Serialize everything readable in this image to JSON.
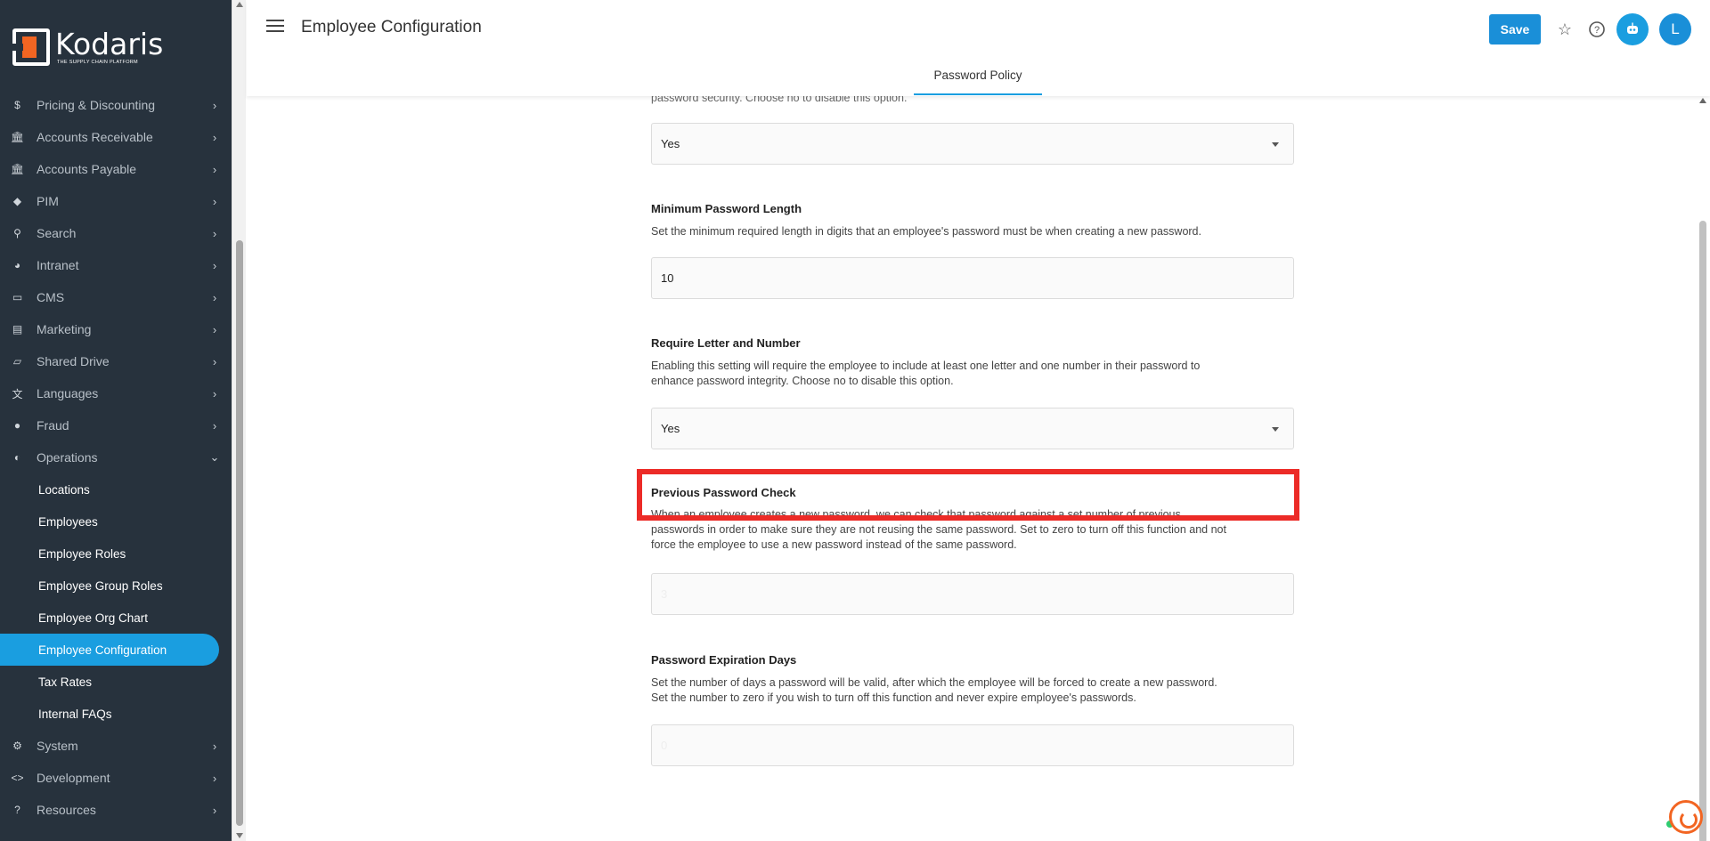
{
  "brand": {
    "name": "Kodaris",
    "tagline": "THE SUPPLY CHAIN PLATFORM"
  },
  "sidebar": {
    "items": [
      {
        "label": "Pricing & Discounting",
        "icon": "dollar-icon",
        "glyph": "$"
      },
      {
        "label": "Accounts Receivable",
        "icon": "bank-icon",
        "glyph": "🏛"
      },
      {
        "label": "Accounts Payable",
        "icon": "bank-icon",
        "glyph": "🏛"
      },
      {
        "label": "PIM",
        "icon": "tag-icon",
        "glyph": "◆"
      },
      {
        "label": "Search",
        "icon": "search-icon",
        "glyph": "⚲"
      },
      {
        "label": "Intranet",
        "icon": "globe-icon",
        "glyph": "◕"
      },
      {
        "label": "CMS",
        "icon": "web-icon",
        "glyph": "▭"
      },
      {
        "label": "Marketing",
        "icon": "id-card-icon",
        "glyph": "▤"
      },
      {
        "label": "Shared Drive",
        "icon": "folder-icon",
        "glyph": "▱"
      },
      {
        "label": "Languages",
        "icon": "translate-icon",
        "glyph": "文"
      },
      {
        "label": "Fraud",
        "icon": "alert-icon",
        "glyph": "●"
      },
      {
        "label": "Operations",
        "icon": "operations-icon",
        "glyph": "◐"
      }
    ],
    "operations_sub": [
      {
        "label": "Locations"
      },
      {
        "label": "Employees"
      },
      {
        "label": "Employee Roles"
      },
      {
        "label": "Employee Group Roles"
      },
      {
        "label": "Employee Org Chart"
      },
      {
        "label": "Employee Configuration"
      },
      {
        "label": "Tax Rates"
      },
      {
        "label": "Internal FAQs"
      }
    ],
    "bottom_items": [
      {
        "label": "System",
        "icon": "gear-icon",
        "glyph": "⚙"
      },
      {
        "label": "Development",
        "icon": "code-icon",
        "glyph": "<>"
      },
      {
        "label": "Resources",
        "icon": "help-icon",
        "glyph": "?"
      }
    ]
  },
  "header": {
    "title": "Employee Configuration",
    "save_label": "Save",
    "avatar_letter": "L",
    "tab_label": "Password Policy"
  },
  "fields": {
    "top_desc_tail": "password security. Choose no to disable this option.",
    "top_value": "Yes",
    "min_length": {
      "title": "Minimum Password Length",
      "desc": "Set the minimum required length in digits that an employee's password must be when creating a new password.",
      "value": "10"
    },
    "letter_number": {
      "title": "Require Letter and Number",
      "desc": "Enabling this setting will require the employee to include at least one letter and one number in their password to enhance password integrity. Choose no to disable this option.",
      "value": "Yes"
    },
    "previous_check": {
      "title": "Previous Password Check",
      "desc_line1": "When an employee creates a new password, we can check that password against a set number of previous",
      "desc_line2": "passwords in order to make sure they are not reusing the same password. Set to zero to turn off this function and not",
      "desc_line3": "force the employee to use a new password instead of the same password.",
      "value": "3"
    },
    "expiration": {
      "title": "Password Expiration Days",
      "desc_line1": "Set the number of days a password will be valid, after which the employee will be forced to create a new password.",
      "desc_line2": "Set the number to zero if you wish to turn off this function and never expire employee's passwords.",
      "value": "0"
    }
  },
  "colors": {
    "accent": "#1a9ee0",
    "sidebar_bg": "#27323d",
    "highlight": "#ec2b27",
    "brand_orange": "#f26522"
  }
}
